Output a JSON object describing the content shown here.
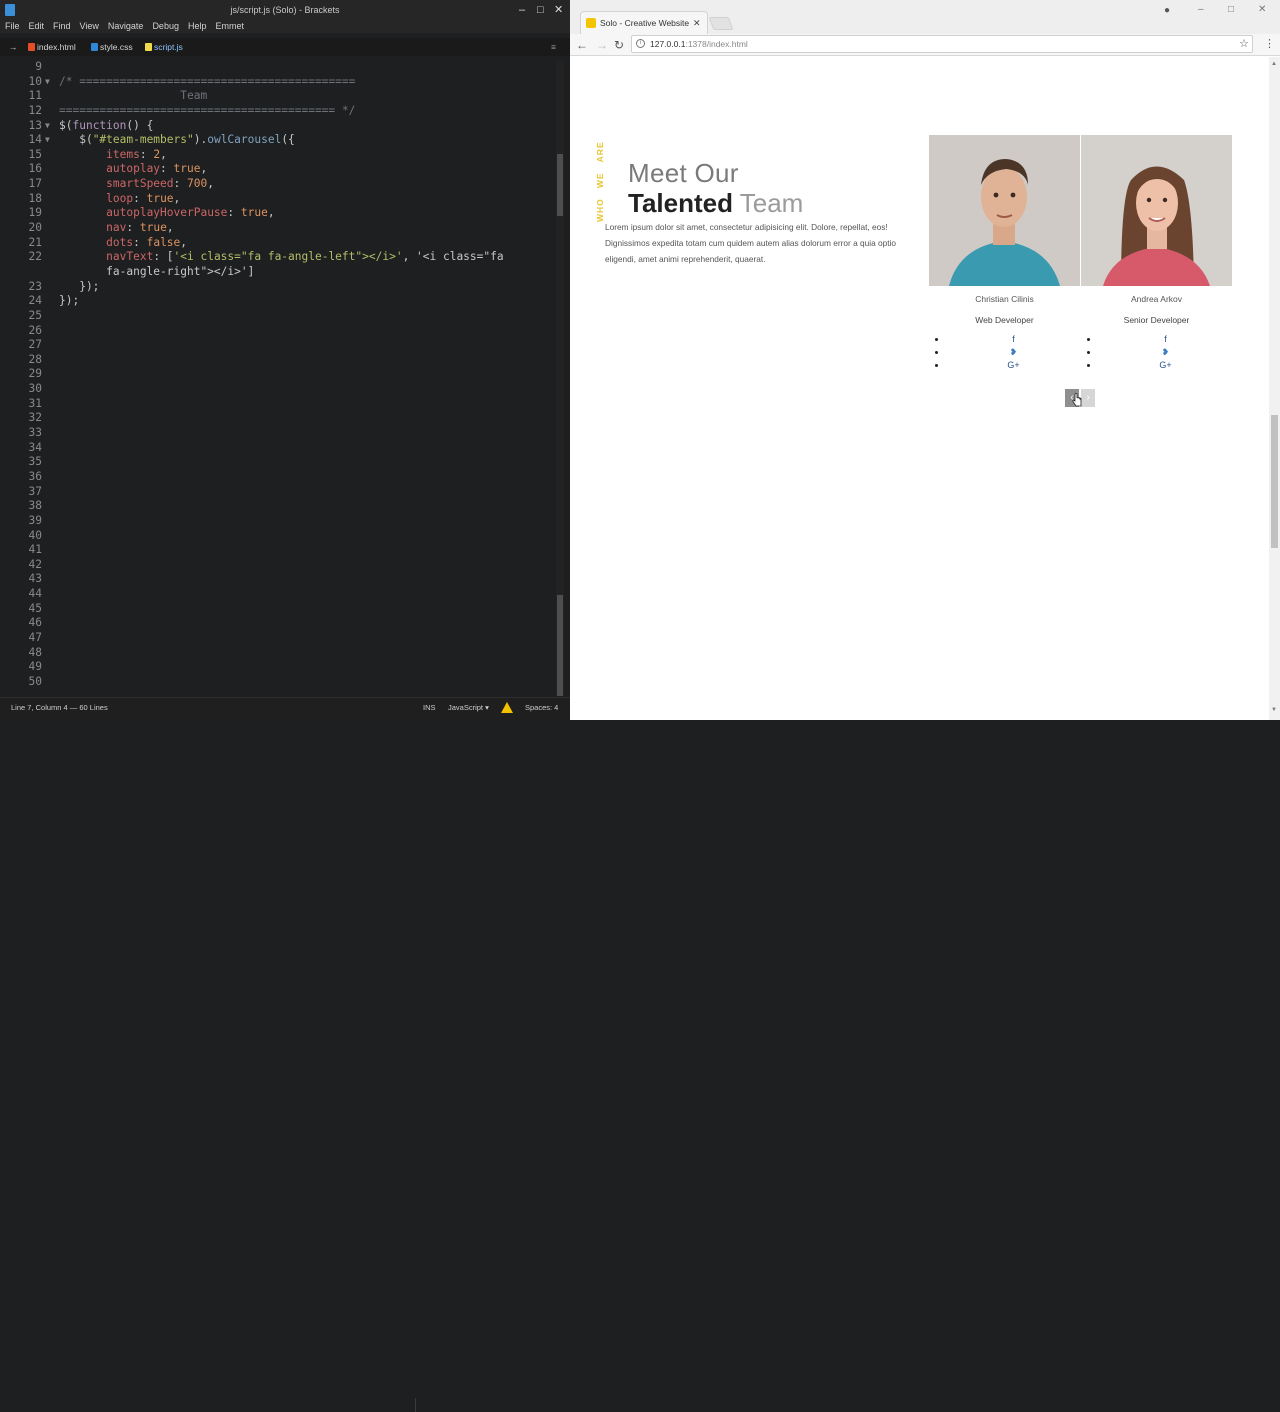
{
  "editor": {
    "title": "js/script.js (Solo) - Brackets",
    "menu": [
      "File",
      "Edit",
      "Find",
      "View",
      "Navigate",
      "Debug",
      "Help",
      "Emmet"
    ],
    "tabs": [
      {
        "label": "index.html",
        "color": "#e44d26"
      },
      {
        "label": "style.css",
        "color": "#2f87d8"
      },
      {
        "label": "script.js",
        "color": "#f0db4f"
      }
    ],
    "status": {
      "position": "Line 7, Column 4",
      "lines": "60 Lines",
      "mode": "INS",
      "language": "JavaScript",
      "spaces": "Spaces: 4"
    },
    "code_lines": [
      {
        "n": "9",
        "fold": "",
        "text": ""
      },
      {
        "n": "10",
        "fold": "▼",
        "text": "/* ========================================="
      },
      {
        "n": "11",
        "fold": "",
        "text": "                  Team"
      },
      {
        "n": "12",
        "fold": "",
        "text": "========================================= */"
      },
      {
        "n": "13",
        "fold": "▼",
        "text": "$(function() {"
      },
      {
        "n": "14",
        "fold": "▼",
        "text": "   $(\"#team-members\").owlCarousel({"
      },
      {
        "n": "15",
        "fold": "",
        "text": "       items: 2,"
      },
      {
        "n": "16",
        "fold": "",
        "text": "       autoplay: true,"
      },
      {
        "n": "17",
        "fold": "",
        "text": "       smartSpeed: 700,"
      },
      {
        "n": "18",
        "fold": "",
        "text": "       loop: true,"
      },
      {
        "n": "19",
        "fold": "",
        "text": "       autoplayHoverPause: true,"
      },
      {
        "n": "20",
        "fold": "",
        "text": "       nav: true,"
      },
      {
        "n": "21",
        "fold": "",
        "text": "       dots: false,"
      },
      {
        "n": "22",
        "fold": "",
        "text": "       navText: ['<i class=\"fa fa-angle-left\"></i>', '<i class=\"fa"
      },
      {
        "n": "",
        "fold": "",
        "text": "       fa-angle-right\"></i>']"
      },
      {
        "n": "23",
        "fold": "",
        "text": "   });"
      },
      {
        "n": "24",
        "fold": "",
        "text": "});"
      },
      {
        "n": "25",
        "fold": "",
        "text": ""
      },
      {
        "n": "26",
        "fold": "",
        "text": ""
      },
      {
        "n": "27",
        "fold": "",
        "text": ""
      },
      {
        "n": "28",
        "fold": "",
        "text": ""
      },
      {
        "n": "29",
        "fold": "",
        "text": ""
      },
      {
        "n": "30",
        "fold": "",
        "text": ""
      },
      {
        "n": "31",
        "fold": "",
        "text": ""
      },
      {
        "n": "32",
        "fold": "",
        "text": ""
      },
      {
        "n": "33",
        "fold": "",
        "text": ""
      },
      {
        "n": "34",
        "fold": "",
        "text": ""
      },
      {
        "n": "35",
        "fold": "",
        "text": ""
      },
      {
        "n": "36",
        "fold": "",
        "text": ""
      },
      {
        "n": "37",
        "fold": "",
        "text": ""
      },
      {
        "n": "38",
        "fold": "",
        "text": ""
      },
      {
        "n": "39",
        "fold": "",
        "text": ""
      },
      {
        "n": "40",
        "fold": "",
        "text": ""
      },
      {
        "n": "41",
        "fold": "",
        "text": ""
      },
      {
        "n": "42",
        "fold": "",
        "text": ""
      },
      {
        "n": "43",
        "fold": "",
        "text": ""
      },
      {
        "n": "44",
        "fold": "",
        "text": ""
      },
      {
        "n": "45",
        "fold": "",
        "text": ""
      },
      {
        "n": "46",
        "fold": "",
        "text": ""
      },
      {
        "n": "47",
        "fold": "",
        "text": ""
      },
      {
        "n": "48",
        "fold": "",
        "text": ""
      },
      {
        "n": "49",
        "fold": "",
        "text": ""
      },
      {
        "n": "50",
        "fold": "",
        "text": ""
      }
    ]
  },
  "browser": {
    "tab_title": "Solo - Creative Website",
    "url_host": "127.0.0.1",
    "url_rest": ":1378/index.html",
    "accent": "#e7c62d"
  },
  "page": {
    "vertical_tag": [
      "Who",
      "We",
      "Are"
    ],
    "heading_light": "Meet Our",
    "heading_strong_bold": "Talented",
    "heading_strong_light": "Team",
    "description": "Lorem ipsum dolor sit amet, consectetur adipisicing elit. Dolore, repellat, eos! Dignissimos expedita totam cum quidem autem alias dolorum error a quia optio eligendi, amet animi reprehenderit, quaerat.",
    "members": [
      {
        "name": "Christian Cilinis",
        "role": "Web Developer",
        "social": [
          "f",
          "t",
          "G+"
        ]
      },
      {
        "name": "Andrea Arkov",
        "role": "Senior Developer",
        "social": [
          "f",
          "t",
          "G+"
        ]
      }
    ],
    "nav_prev": "‹",
    "nav_next": "›"
  }
}
